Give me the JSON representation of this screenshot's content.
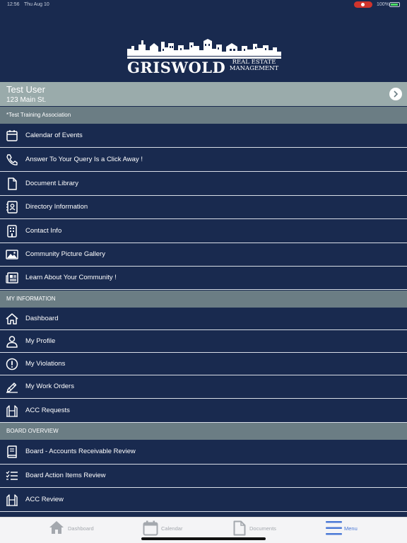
{
  "status_bar": {
    "time": "12:56",
    "date": "Thu Aug 10",
    "battery": "100%"
  },
  "logo": {
    "brand": "GRISWOLD",
    "sub_line1": "REAL ESTATE",
    "sub_line2": "MANAGEMENT"
  },
  "user": {
    "name": "Test User",
    "address": "123 Main St."
  },
  "association_header": "*Test Training Association",
  "association_items": [
    {
      "label": "Calendar of Events",
      "icon": "calendar-icon"
    },
    {
      "label": "Answer To Your Query Is a Click Away !",
      "icon": "phone-icon"
    },
    {
      "label": "Document Library",
      "icon": "document-icon"
    },
    {
      "label": "Directory Information",
      "icon": "contact-card-icon"
    },
    {
      "label": "Contact Info",
      "icon": "building-icon"
    },
    {
      "label": "Community Picture Gallery",
      "icon": "image-icon"
    },
    {
      "label": "Learn About Your Community !",
      "icon": "newspaper-icon"
    }
  ],
  "my_info_header": "MY INFORMATION",
  "my_info_items": [
    {
      "label": "Dashboard",
      "icon": "home-icon"
    },
    {
      "label": "My Profile",
      "icon": "person-icon"
    },
    {
      "label": "My Violations",
      "icon": "alert-circle-icon"
    },
    {
      "label": "My Work Orders",
      "icon": "pencil-icon"
    },
    {
      "label": "ACC Requests",
      "icon": "acc-icon"
    }
  ],
  "board_header": "BOARD OVERVIEW",
  "board_items": [
    {
      "label": "Board - Accounts Receivable Review",
      "icon": "book-icon"
    },
    {
      "label": "Board Action Items Review",
      "icon": "checklist-icon"
    },
    {
      "label": "ACC Review",
      "icon": "acc-icon"
    }
  ],
  "tabs": [
    {
      "label": "Dashboard",
      "icon": "home-icon"
    },
    {
      "label": "Calendar",
      "icon": "calendar-icon"
    },
    {
      "label": "Documents",
      "icon": "document-icon"
    },
    {
      "label": "Menu",
      "icon": "menu-icon"
    }
  ]
}
